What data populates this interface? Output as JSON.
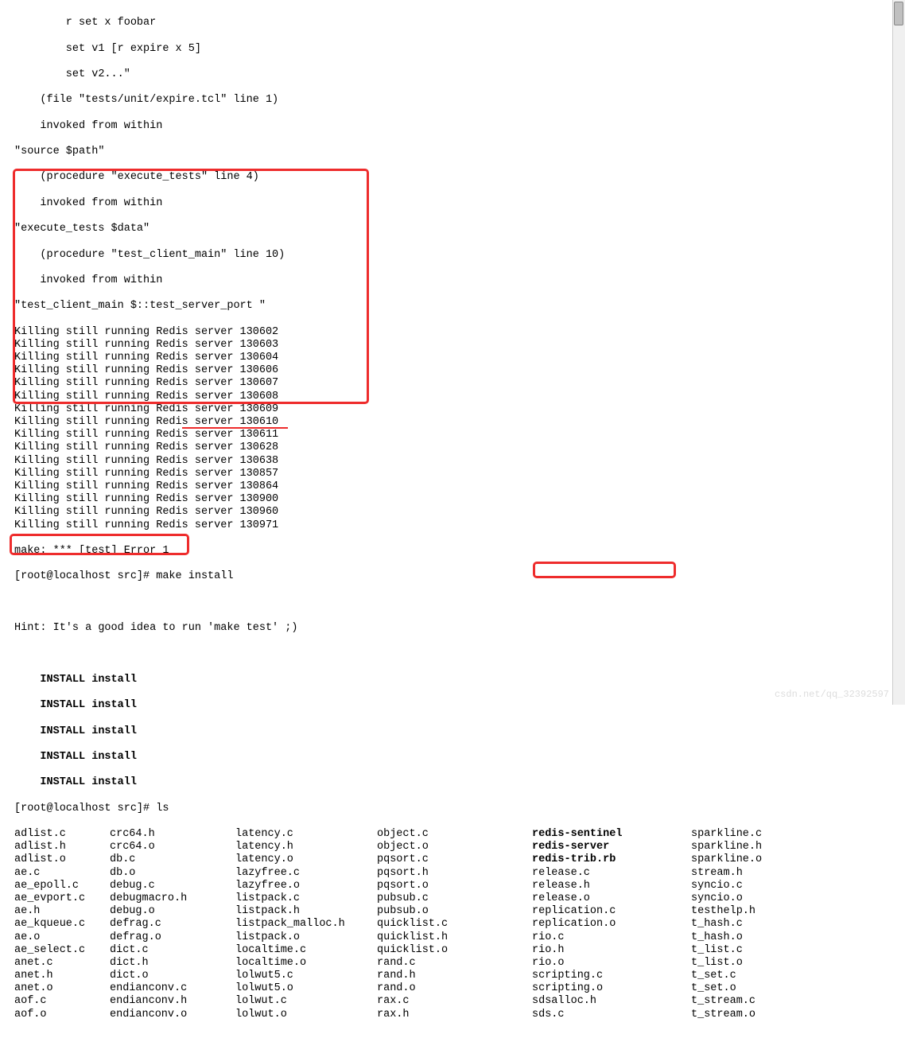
{
  "traceback": {
    "l1": "        r set x foobar",
    "l2": "        set v1 [r expire x 5]",
    "l3": "        set v2...\"",
    "l4": "    (file \"tests/unit/expire.tcl\" line 1)",
    "l5": "    invoked from within",
    "l6": "\"source $path\"",
    "l7": "    (procedure \"execute_tests\" line 4)",
    "l8": "    invoked from within",
    "l9": "\"execute_tests $data\"",
    "l10": "    (procedure \"test_client_main\" line 10)",
    "l11": "    invoked from within",
    "l12": "\"test_client_main $::test_server_port \""
  },
  "killing": {
    "prefix": "Killing still running Redis server ",
    "pids": [
      "130602",
      "130603",
      "130604",
      "130606",
      "130607",
      "130608",
      "130609",
      "130610",
      "130611",
      "130628",
      "130638",
      "130857",
      "130864",
      "130900",
      "130960",
      "130971"
    ]
  },
  "make_error": "make: *** [test] Error 1",
  "prompt1": "[root@localhost src]# make install",
  "hint": "Hint: It's a good idea to run 'make test' ;)",
  "install": {
    "l": "    INSTALL install"
  },
  "prompt2": "[root@localhost src]# ls",
  "files": {
    "bold": [
      "redis-sentinel",
      "redis-server",
      "redis-trib.rb"
    ],
    "cols": [
      [
        "adlist.c",
        "adlist.h",
        "adlist.o",
        "ae.c",
        "ae_epoll.c",
        "ae_evport.c",
        "ae.h",
        "ae_kqueue.c",
        "ae.o",
        "ae_select.c",
        "anet.c",
        "anet.h",
        "anet.o",
        "aof.c",
        "aof.o"
      ],
      [
        "crc64.h",
        "crc64.o",
        "db.c",
        "db.o",
        "debug.c",
        "debugmacro.h",
        "debug.o",
        "defrag.c",
        "defrag.o",
        "dict.c",
        "dict.h",
        "dict.o",
        "endianconv.c",
        "endianconv.h",
        "endianconv.o"
      ],
      [
        "latency.c",
        "latency.h",
        "latency.o",
        "lazyfree.c",
        "lazyfree.o",
        "listpack.c",
        "listpack.h",
        "listpack_malloc.h",
        "listpack.o",
        "localtime.c",
        "localtime.o",
        "lolwut5.c",
        "lolwut5.o",
        "lolwut.c",
        "lolwut.o"
      ],
      [
        "object.c",
        "object.o",
        "pqsort.c",
        "pqsort.h",
        "pqsort.o",
        "pubsub.c",
        "pubsub.o",
        "quicklist.c",
        "quicklist.h",
        "quicklist.o",
        "rand.c",
        "rand.h",
        "rand.o",
        "rax.c",
        "rax.h"
      ],
      [
        "redis-sentinel",
        "redis-server",
        "redis-trib.rb",
        "release.c",
        "release.h",
        "release.o",
        "replication.c",
        "replication.o",
        "rio.c",
        "rio.h",
        "rio.o",
        "scripting.c",
        "scripting.o",
        "sdsalloc.h",
        "sds.c"
      ],
      [
        "sparkline.c",
        "sparkline.h",
        "sparkline.o",
        "stream.h",
        "syncio.c",
        "syncio.o",
        "testhelp.h",
        "t_hash.c",
        "t_hash.o",
        "t_list.c",
        "t_list.o",
        "t_set.c",
        "t_set.o",
        "t_stream.c",
        "t_stream.o"
      ]
    ]
  },
  "watermark": "csdn.net/qq_32392597"
}
